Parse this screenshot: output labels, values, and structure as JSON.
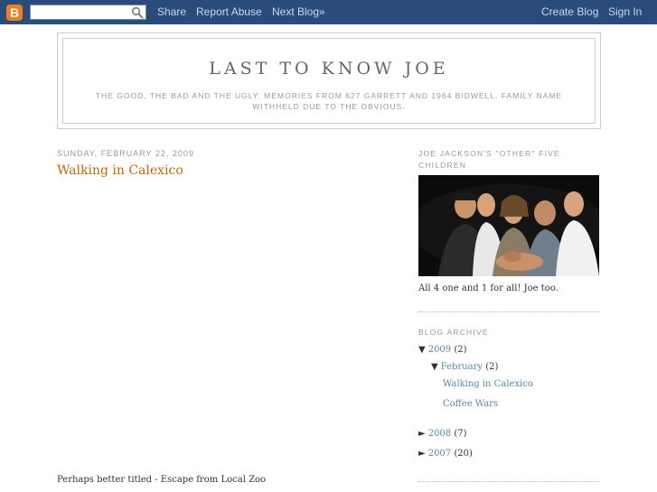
{
  "navbar": {
    "logo_letter": "B",
    "search_value": "",
    "links": {
      "share": "Share",
      "report_abuse": "Report Abuse",
      "next_blog": "Next Blog»",
      "create_blog": "Create Blog",
      "sign_in": "Sign In"
    },
    "icons": {
      "logo": "blogger-logo-icon",
      "search": "search-icon"
    },
    "colors": {
      "bar": "#2a4c7a",
      "logo": "#f27c1f"
    }
  },
  "header": {
    "title": "LAST TO KNOW JOE",
    "description": "THE GOOD, THE BAD AND THE UGLY. MEMORIES FROM 627 GARRETT AND 1964 BIDWELL. FAMILY NAME WITHHELD DUE TO THE OBVIOUS."
  },
  "post": {
    "date": "SUNDAY, FEBRUARY 22, 2009",
    "title": "Walking in Calexico",
    "body_first_line": "Perhaps better titled - Escape from Local Zoo"
  },
  "sidebar": {
    "photo_widget": {
      "heading": "JOE JACKSON'S \"OTHER\" FIVE CHILDREN",
      "caption": "All 4 one and 1 for all! Joe too."
    },
    "archive": {
      "heading": "BLOG ARCHIVE",
      "toggle_expanded": "▼",
      "toggle_collapsed": "►",
      "years": [
        {
          "label": "2009",
          "count": "(2)",
          "expanded": true
        },
        {
          "label": "2008",
          "count": "(7)",
          "expanded": false
        },
        {
          "label": "2007",
          "count": "(20)",
          "expanded": false
        }
      ],
      "month": {
        "label": "February",
        "count": "(2)"
      },
      "posts": [
        "Walking in Calexico",
        "Coffee Wars"
      ]
    }
  },
  "colors": {
    "link": "#5588aa",
    "post_title": "#cc6600"
  }
}
